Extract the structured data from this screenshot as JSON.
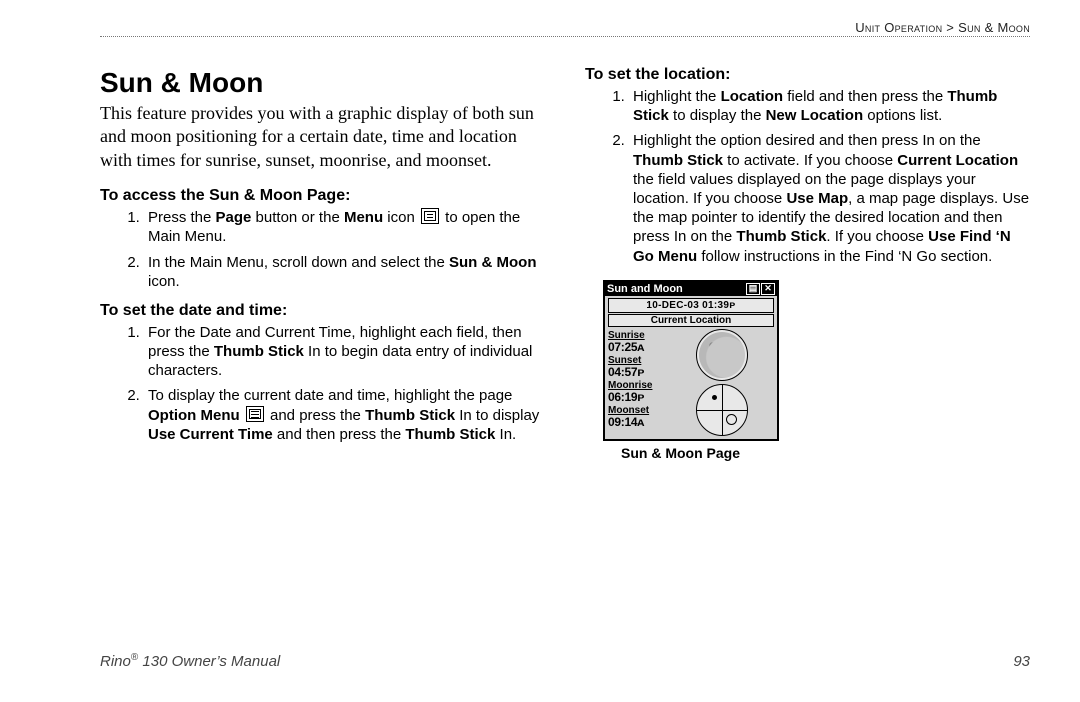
{
  "header": {
    "breadcrumb_a": "Unit Operation",
    "sep": " > ",
    "breadcrumb_b": "Sun & Moon"
  },
  "left": {
    "title": "Sun & Moon",
    "intro": "This feature provides you with a graphic display of both sun and moon positioning for a certain date, time and location with times for sunrise, sunset, moonrise, and moonset.",
    "access_head": "To access the Sun & Moon Page:",
    "access_step1_a": "Press the ",
    "access_step1_page": "Page",
    "access_step1_b": " button or the ",
    "access_step1_menu": "Menu",
    "access_step1_c": " icon ",
    "access_step1_d": " to open the Main Menu.",
    "access_step2_a": "In the Main Menu, scroll down and select the ",
    "access_step2_bold": "Sun & Moon",
    "access_step2_b": " icon.",
    "date_head": "To set the date and time:",
    "date_step1_a": "For the Date and Current Time, highlight each field, then press the ",
    "date_step1_bold": "Thumb Stick",
    "date_step1_b": " In to begin data entry of individual characters.",
    "date_step2_a": "To display the current date and time, highlight the page ",
    "date_step2_bold1": "Option Menu",
    "date_step2_b": " ",
    "date_step2_c": " and press the ",
    "date_step2_bold2": "Thumb Stick",
    "date_step2_d": " In to display ",
    "date_step2_bold3": "Use Current Time",
    "date_step2_e": " and then press the ",
    "date_step2_bold4": "Thumb Stick",
    "date_step2_f": " In."
  },
  "right": {
    "loc_head": "To set the location:",
    "loc_step1_a": "Highlight the ",
    "loc_step1_bold1": "Location",
    "loc_step1_b": " field and then press the ",
    "loc_step1_bold2": "Thumb Stick",
    "loc_step1_c": " to display the ",
    "loc_step1_bold3": "New Location",
    "loc_step1_d": " options list.",
    "loc_step2_a": "Highlight the option desired and then press In on the ",
    "loc_step2_bold1": "Thumb Stick",
    "loc_step2_b": " to activate. If you choose ",
    "loc_step2_bold2": "Current Location",
    "loc_step2_c": " the field values displayed on the page displays your location. If you choose ",
    "loc_step2_bold3": "Use Map",
    "loc_step2_d": ", a map page displays. Use the map pointer to identify the desired location and then press In on the ",
    "loc_step2_bold4": "Thumb Stick",
    "loc_step2_e": ". If you choose ",
    "loc_step2_bold5": "Use Find ‘N Go Menu",
    "loc_step2_f": " follow instructions in the Find ‘N Go section."
  },
  "device": {
    "title": "Sun and Moon",
    "date_time": "10-DEC-03 01:39ᴘ",
    "location": "Current Location",
    "labels": {
      "sunrise": "Sunrise",
      "sunset": "Sunset",
      "moonrise": "Moonrise",
      "moonset": "Moonset"
    },
    "values": {
      "sunrise": "07:25ᴀ",
      "sunset": "04:57ᴘ",
      "moonrise": "06:19ᴘ",
      "moonset": "09:14ᴀ"
    },
    "caption": "Sun & Moon Page"
  },
  "footer": {
    "left_a": "Rino",
    "left_reg": "®",
    "left_b": " 130 Owner’s Manual",
    "page_no": "93"
  }
}
